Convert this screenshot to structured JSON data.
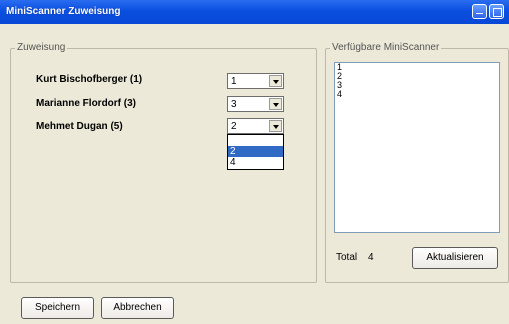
{
  "window": {
    "title": "MiniScanner Zuweisung"
  },
  "zuweisung": {
    "legend": "Zuweisung",
    "rows": [
      {
        "name": "Kurt Bischofberger (1)",
        "value": "1"
      },
      {
        "name": "Marianne Flordorf (3)",
        "value": "3"
      },
      {
        "name": "Mehmet Dugan (5)",
        "value": "2"
      }
    ],
    "dropdown_options": [
      "",
      "2",
      "4"
    ],
    "dropdown_selected_index": 1
  },
  "verfuegbar": {
    "legend": "Verfügbare MiniScanner",
    "items": [
      "1",
      "2",
      "3",
      "4"
    ],
    "total_label": "Total",
    "total_value": "4",
    "refresh_label": "Aktualisieren"
  },
  "footer": {
    "save_label": "Speichern",
    "cancel_label": "Abbrechen"
  }
}
